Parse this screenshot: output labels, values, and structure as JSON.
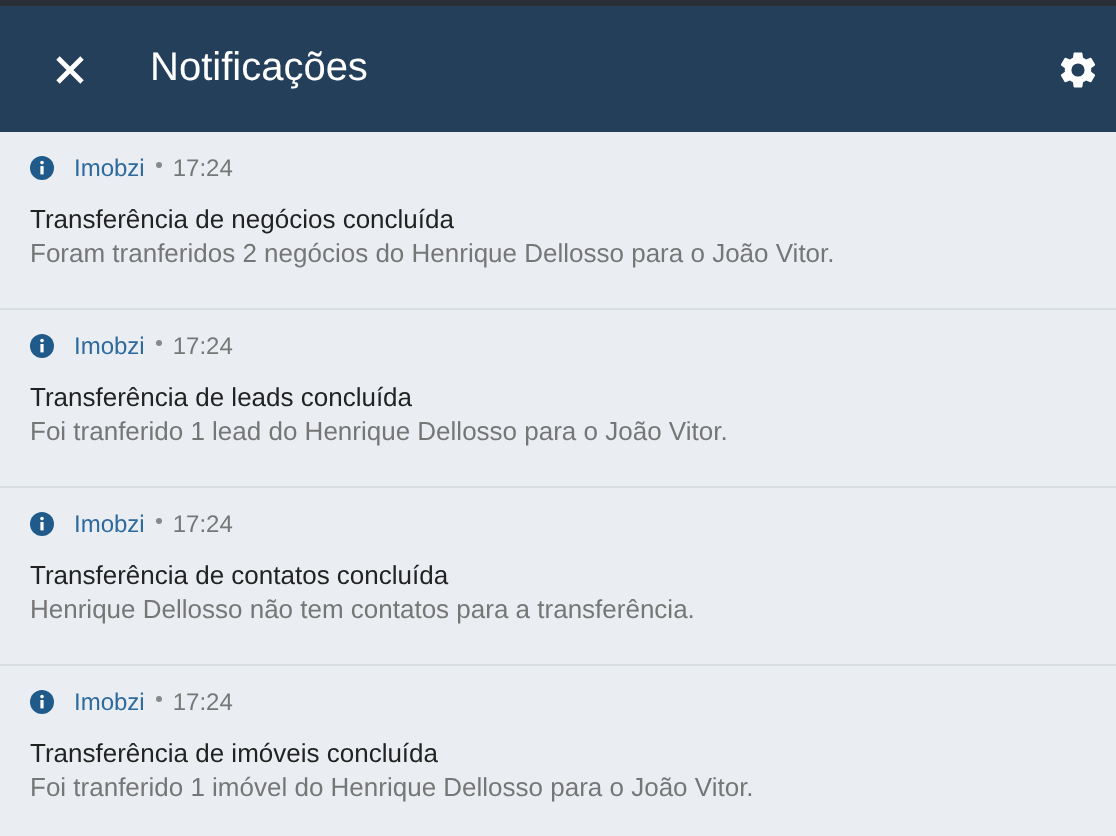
{
  "header": {
    "title": "Notificações"
  },
  "notifications": [
    {
      "source": "Imobzi",
      "time": "17:24",
      "title": "Transferência de negócios concluída",
      "message": "Foram tranferidos 2 negócios do Henrique Dellosso para o João Vitor."
    },
    {
      "source": "Imobzi",
      "time": "17:24",
      "title": "Transferência de leads concluída",
      "message": "Foi tranferido 1 lead do Henrique Dellosso para o João Vitor."
    },
    {
      "source": "Imobzi",
      "time": "17:24",
      "title": "Transferência de contatos concluída",
      "message": "Henrique Dellosso não tem contatos para a transferência."
    },
    {
      "source": "Imobzi",
      "time": "17:24",
      "title": "Transferência de imóveis concluída",
      "message": "Foi tranferido 1 imóvel do Henrique Dellosso para o João Vitor."
    }
  ]
}
